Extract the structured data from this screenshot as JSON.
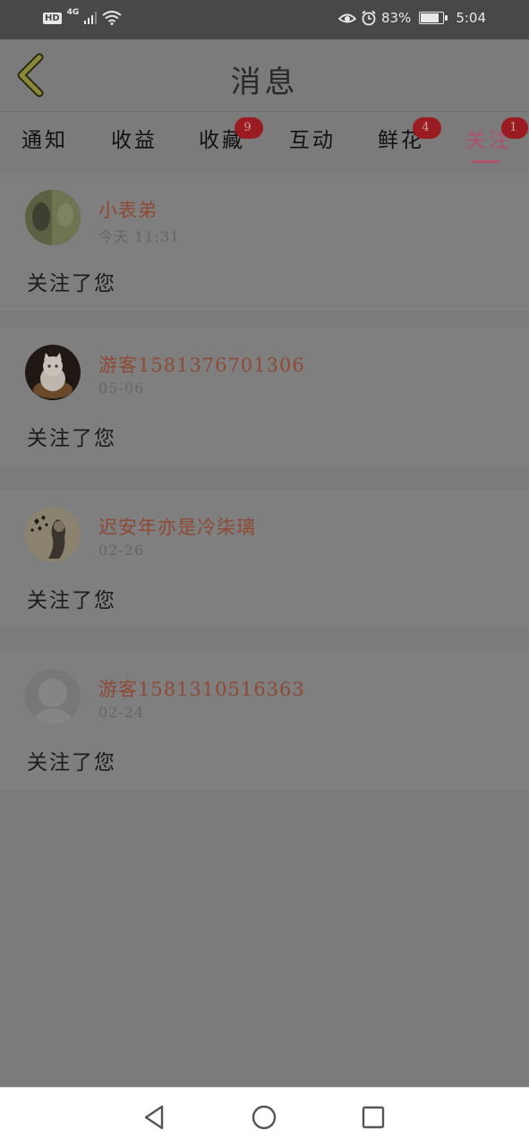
{
  "status_bar": {
    "hd": "HD",
    "network": "4G",
    "battery_percent": "83%",
    "battery_level": 0.83,
    "time": "5:04"
  },
  "header": {
    "title": "消息"
  },
  "tabs": [
    {
      "label": "通知",
      "badge": ""
    },
    {
      "label": "收益",
      "badge": ""
    },
    {
      "label": "收藏",
      "badge": "9"
    },
    {
      "label": "互动",
      "badge": ""
    },
    {
      "label": "鲜花",
      "badge": "4"
    },
    {
      "label": "关注",
      "badge": "1",
      "active": true
    }
  ],
  "messages": [
    {
      "name": "小表弟",
      "time": "今天 11:31",
      "text": "关注了您",
      "avatar": "photo-avatar"
    },
    {
      "name": "游客1581376701306",
      "time": "05-06",
      "text": "关注了您",
      "avatar": "cat-avatar"
    },
    {
      "name": "迟安年亦是冷柒璃",
      "time": "02-26",
      "text": "关注了您",
      "avatar": "hearts-avatar"
    },
    {
      "name": "游客1581310516363",
      "time": "02-24",
      "text": "关注了您",
      "avatar": "default-avatar"
    }
  ],
  "colors": {
    "accent": "#b0526e",
    "badge": "#9a1c22",
    "username": "#8e4a34"
  }
}
